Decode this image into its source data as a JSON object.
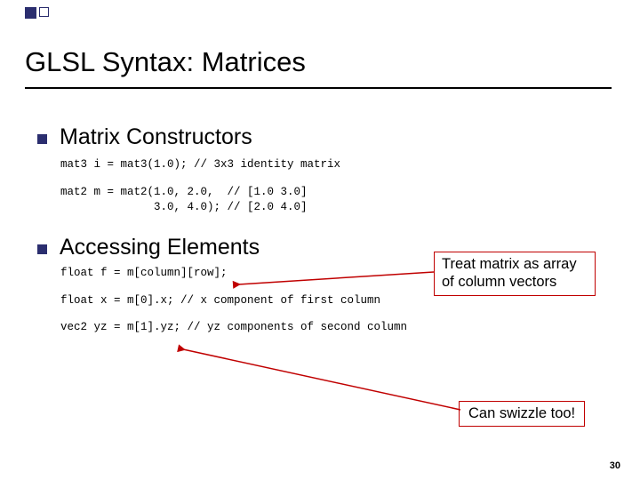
{
  "title": "GLSL Syntax:  Matrices",
  "sections": {
    "constructors": {
      "title": "Matrix Constructors",
      "code1": "mat3 i = mat3(1.0); // 3x3 identity matrix",
      "code2": "mat2 m = mat2(1.0, 2.0,  // [1.0 3.0]\n              3.0, 4.0); // [2.0 4.0]"
    },
    "accessing": {
      "title": "Accessing Elements",
      "code1": "float f = m[column][row];",
      "code2": "float x = m[0].x; // x component of first column",
      "code3": "vec2 yz = m[1].yz; // yz components of second column"
    }
  },
  "callouts": {
    "array_note": "Treat matrix as array of column vectors",
    "swizzle_note": "Can swizzle too!"
  },
  "page_number": "30"
}
